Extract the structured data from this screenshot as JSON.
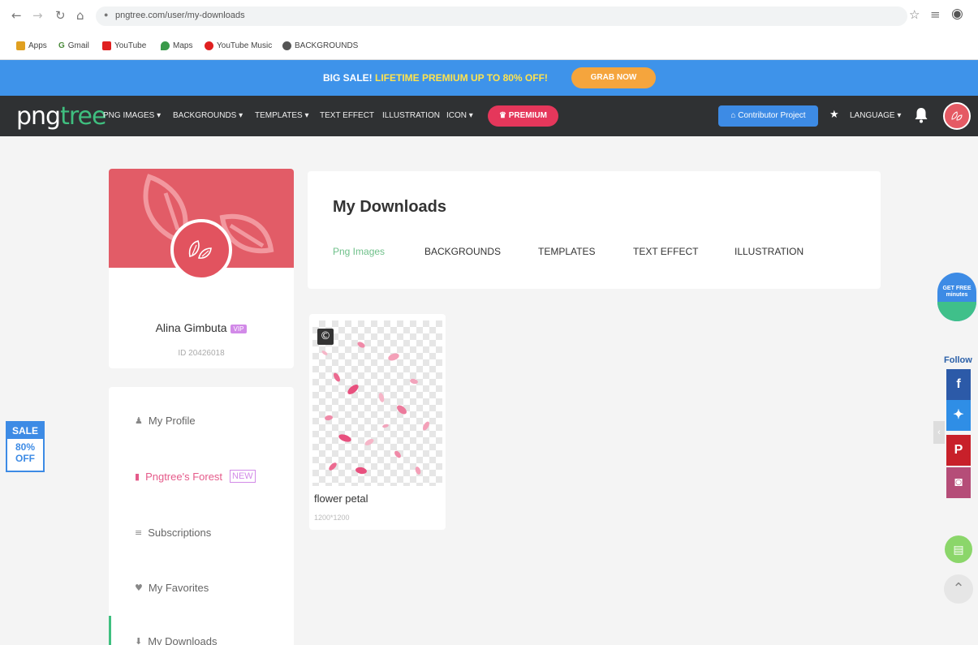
{
  "browser": {
    "url": "pngtree.com/user/my-downloads",
    "bookmarks": [
      "Apps",
      "Gmail",
      "YouTube",
      "Maps",
      "YouTube Music",
      "BACKGROUNDS"
    ]
  },
  "banner": {
    "prefix": "BIG SALE!",
    "highlight": "LIFETIME PREMIUM UP TO 80% OFF!",
    "button": "GRAB NOW"
  },
  "nav": {
    "logo_a": "png",
    "logo_b": "tree",
    "links": [
      "PNG IMAGES ▾",
      "BACKGROUNDS ▾",
      "TEMPLATES ▾",
      "TEXT EFFECT",
      "ILLUSTRATION",
      "ICON ▾"
    ],
    "premium": "PREMIUM",
    "contributor": "Contributor Project",
    "language": "LANGUAGE ▾"
  },
  "profile": {
    "name": "Alina Gimbuta",
    "badge": "VIP",
    "id": "ID 20426018"
  },
  "menu": {
    "my_profile": "My Profile",
    "forest": "Pngtree's Forest",
    "forest_tag": "NEW",
    "subscriptions": "Subscriptions",
    "favorites": "My Favorites",
    "downloads": "My Downloads"
  },
  "downloads": {
    "title": "My Downloads",
    "tabs": [
      "Png Images",
      "BACKGROUNDS",
      "TEMPLATES",
      "TEXT EFFECT",
      "ILLUSTRATION"
    ],
    "item": {
      "title": "flower petal",
      "dimensions": "1200*1200"
    }
  },
  "sale_badge": {
    "top": "SALE",
    "line1": "80%",
    "line2": "OFF"
  },
  "side": {
    "free_line1": "GET FREE",
    "free_line2": "minutes",
    "follow": "Follow"
  },
  "colors": {
    "banner": "#3e93ea",
    "nav": "#2f3133",
    "premium": "#e5375b",
    "accent_green": "#3fbf7f",
    "profile_cover": "#e25c67"
  }
}
